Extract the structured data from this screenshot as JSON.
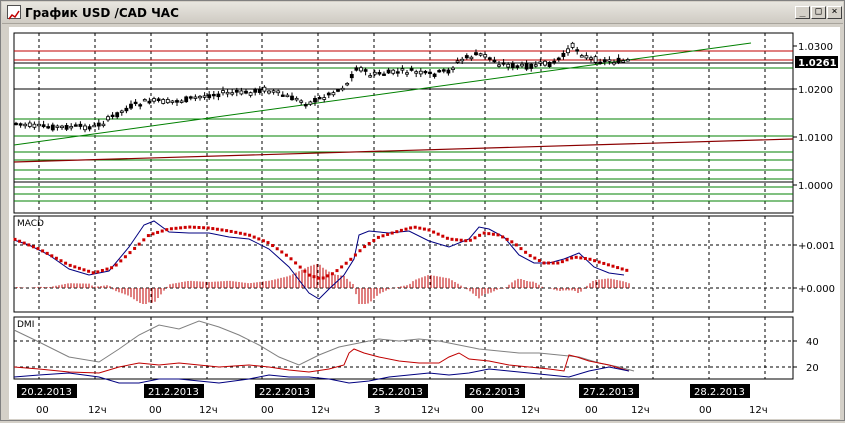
{
  "window": {
    "title": "График USD /CAD  ЧАС",
    "minimize_glyph": "_",
    "maximize_glyph": "□",
    "close_glyph": "×"
  },
  "price_panel": {
    "current_price": "1.0261",
    "y_ticks": [
      "1.0300",
      "1.0200",
      "1.0100",
      "1.0000"
    ]
  },
  "macd_panel": {
    "label": "MACD",
    "y_ticks": [
      "+0.001",
      "+0.000"
    ]
  },
  "dmi_panel": {
    "label": "DMI",
    "y_ticks": [
      "40",
      "20"
    ]
  },
  "time_axis": {
    "dates": [
      "20.2.2013",
      "21.2.2013",
      "22.2.2013",
      "25.2.2013",
      "26.2.2013",
      "27.2.2013",
      "28.2.2013"
    ],
    "hour_labels": [
      "00",
      "12ч",
      "00",
      "12ч",
      "00",
      "12ч",
      "3",
      "12ч",
      "00",
      "12ч",
      "00",
      "12ч",
      "00",
      "12ч"
    ]
  },
  "colors": {
    "support_lines": "#008000",
    "resistance_lines": "#c00000",
    "macd_signal": "#cc0000",
    "macd_line": "#000080",
    "price_badge_bg": "#000000"
  }
}
